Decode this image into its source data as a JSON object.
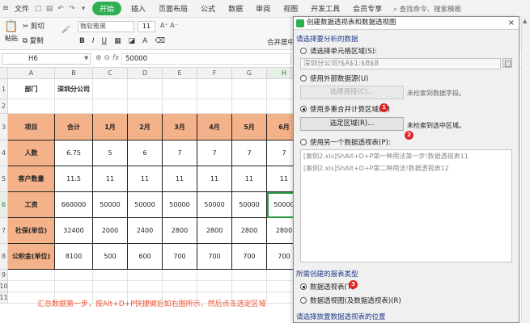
{
  "menubar": {
    "file": "文件",
    "items": [
      "开始",
      "插入",
      "页面布局",
      "公式",
      "数据",
      "审阅",
      "视图",
      "开发工具",
      "会员专享"
    ],
    "active_index": 0,
    "search": "查找命令、搜索模板"
  },
  "toolbar": {
    "paste": "粘贴",
    "cut": "剪切",
    "copy": "复制",
    "brush": "格式刷",
    "font": "微软雅黑",
    "size": "11",
    "size_inc": "A⁺ A⁻",
    "merge": "合并居中"
  },
  "formula_bar": {
    "cell_ref": "H6",
    "fx": "fx",
    "value": "50000"
  },
  "grid": {
    "columns": [
      "A",
      "B",
      "C",
      "D",
      "E",
      "F",
      "G",
      "H"
    ],
    "rows": [
      "1",
      "2",
      "3",
      "4",
      "5",
      "6",
      "7",
      "8",
      "9",
      "10",
      "11"
    ],
    "selected_column": "H",
    "selected_row": "6",
    "r1": [
      "部门",
      "深圳分公司"
    ],
    "header_row": [
      "项目",
      "合计",
      "1月",
      "2月",
      "3月",
      "4月",
      "5月",
      "6月"
    ],
    "data_rows": [
      {
        "label": "人数",
        "values": [
          "6.75",
          "5",
          "6",
          "7",
          "7",
          "7",
          "7"
        ]
      },
      {
        "label": "客户数量",
        "values": [
          "11.5",
          "11",
          "11",
          "11",
          "11",
          "11",
          "11"
        ]
      },
      {
        "label": "工资",
        "values": [
          "660000",
          "50000",
          "50000",
          "50000",
          "50000",
          "50000",
          "50000"
        ]
      },
      {
        "label": "社保(单位)",
        "values": [
          "32400",
          "2000",
          "2400",
          "2800",
          "2800",
          "2800",
          "2800"
        ]
      },
      {
        "label": "公积金(单位)",
        "values": [
          "8100",
          "500",
          "600",
          "700",
          "700",
          "700",
          "700"
        ]
      }
    ],
    "note": "汇总数据第一步，按Alt+D+P快捷键后如右图所示，然后点击选定区域"
  },
  "dialog": {
    "title": "创建数据透视表和数据透视图",
    "close": "×",
    "section1": "请选择要分析的数据",
    "opt_single_range": "请选择单元格区域(S):",
    "range_value": "深圳分公司!$A$1:$B$8",
    "opt_external": "使用外部数据源(U)",
    "btn_choose_conn": "选择连接(C)...",
    "no_fields": "未检索到数据字段。",
    "opt_multi": "使用多重合并计算区域(M)",
    "btn_select_range": "选定区域(R)...",
    "no_selection": "未检索到选中区域。",
    "opt_another": "使用另一个数据透视表(P):",
    "list_items": [
      "[案例2.xls]ShAlt+D+P第一种用法第一步!数据透视表11",
      "[案例2.xls]ShAlt+D+P第二种用法!数据透视表12"
    ],
    "section2": "所需创建的报表类型",
    "opt_pivot_table": "数据透视表(T)",
    "opt_pivot_chart": "数据透视图(及数据透视表)(R)",
    "section3": "请选择放置数据透视表的位置",
    "badges": [
      "1",
      "2",
      "3"
    ]
  }
}
